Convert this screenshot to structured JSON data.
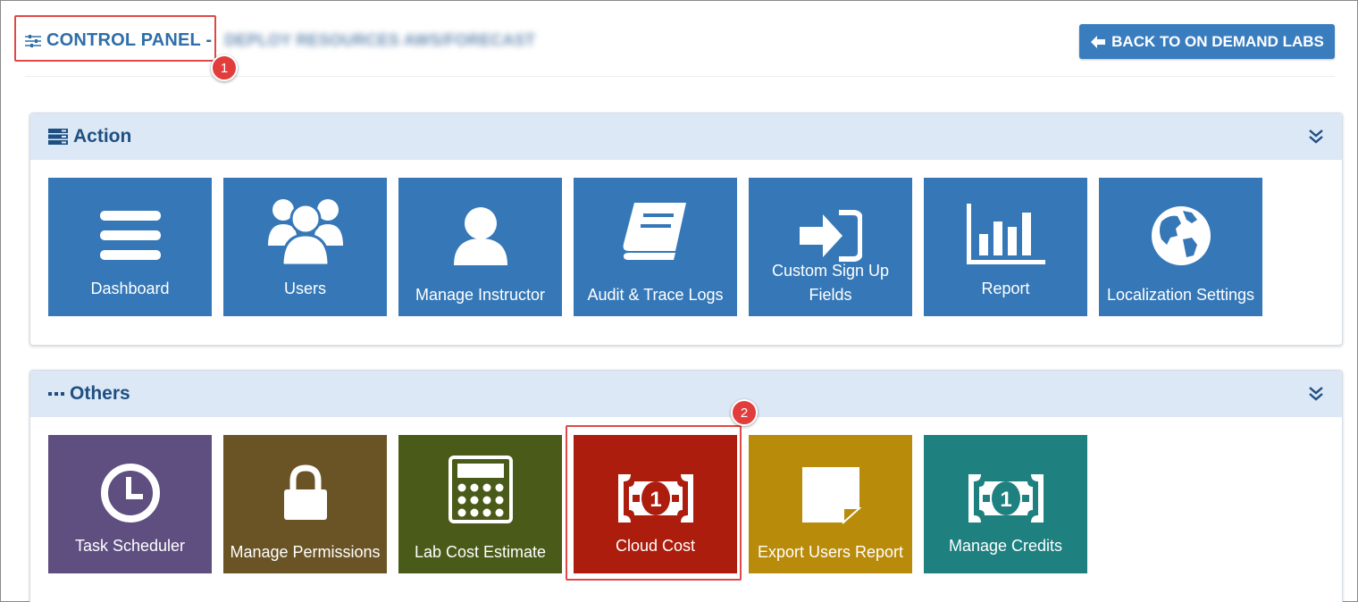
{
  "header": {
    "title": "CONTROL PANEL -",
    "subtitle": "DEPLOY RESOURCES AWS/FORECAST",
    "back_button": "BACK TO ON DEMAND LABS"
  },
  "callouts": [
    "1",
    "2"
  ],
  "action_panel": {
    "title": "Action",
    "tiles": [
      {
        "label": "Dashboard",
        "icon": "dashboard-icon"
      },
      {
        "label": "Users",
        "icon": "users-icon"
      },
      {
        "label": "Manage Instructor",
        "icon": "user-icon"
      },
      {
        "label": "Audit & Trace Logs",
        "icon": "book-icon"
      },
      {
        "label": "Custom Sign Up Fields",
        "icon": "sign-in-icon"
      },
      {
        "label": "Report",
        "icon": "bar-chart-icon"
      },
      {
        "label": "Localization Settings",
        "icon": "globe-icon"
      }
    ]
  },
  "others_panel": {
    "title": "Others",
    "tiles": [
      {
        "label": "Task Scheduler",
        "icon": "clock-icon",
        "color": "#5e4f80"
      },
      {
        "label": "Manage Permissions",
        "icon": "lock-icon",
        "color": "#6a5426"
      },
      {
        "label": "Lab Cost Estimate",
        "icon": "calculator-icon",
        "color": "#4a5a18"
      },
      {
        "label": "Cloud Cost",
        "icon": "money-icon",
        "color": "#ac1d0e"
      },
      {
        "label": "Export Users Report",
        "icon": "sticky-note-icon",
        "color": "#b88b0a"
      },
      {
        "label": "Manage Credits",
        "icon": "money-icon",
        "color": "#1f8080"
      }
    ]
  },
  "colors": {
    "action_tile": "#3678b7",
    "panel_header_bg": "#dce8f6",
    "callout": "#e23d3d"
  }
}
